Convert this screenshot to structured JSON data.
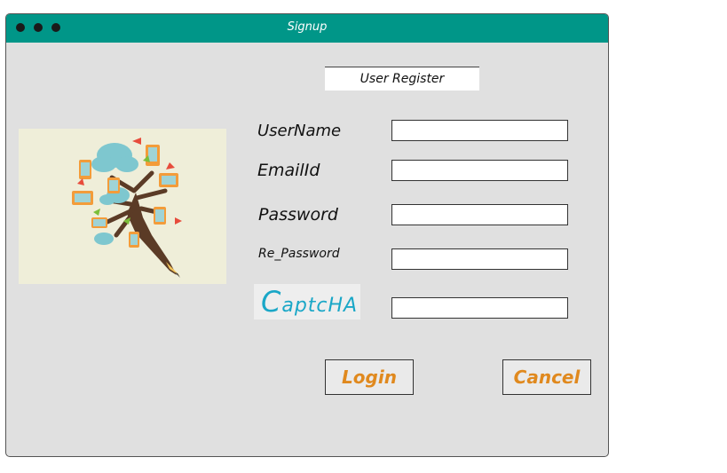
{
  "window": {
    "title": "Signup"
  },
  "form": {
    "header": "User Register",
    "fields": [
      {
        "label": "UserName",
        "value": ""
      },
      {
        "label": "EmailId",
        "value": ""
      },
      {
        "label": "Password",
        "value": ""
      },
      {
        "label": "Re_Password",
        "value": ""
      }
    ],
    "captcha": {
      "first": "C",
      "rest": "aptcHA",
      "value": ""
    }
  },
  "buttons": {
    "login": "Login",
    "cancel": "Cancel"
  },
  "colors": {
    "titlebar": "#009688",
    "button_text": "#e0891e",
    "captcha": "#1aa7c7",
    "panel": "#e0e0e0"
  },
  "illustration": {
    "icon": "tech-tree-pencil-icon"
  }
}
